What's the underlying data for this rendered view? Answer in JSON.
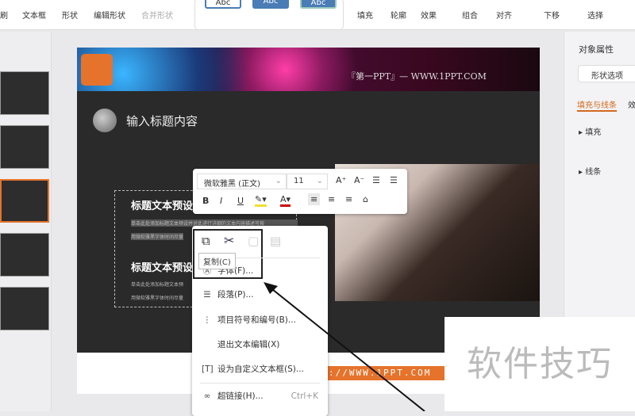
{
  "ribbon": {
    "items": [
      "文本框",
      "形状",
      "编辑形状",
      "合并形状",
      "填充",
      "轮廓",
      "效果",
      "组合",
      "对齐",
      "下移",
      "选择"
    ],
    "styles": [
      "Abc",
      "Abc",
      "Abc"
    ],
    "left_fragment": "刷"
  },
  "slide": {
    "header_text": "『第一PPT』— WWW.1PPT.COM",
    "title": "输入标题内容",
    "block_title_1": "标题文本预设",
    "block_text_1a": "单击此处添加标题文本预设并对此进行详细的文本内容描述可按",
    "block_text_1b": "用微软雅黑字体时间尽量",
    "block_title_2": "标题文本预设",
    "block_text_2a": "单击此处添加标题文本预",
    "block_text_2b": "用微软雅黑字体时间尽量",
    "footer_url": "://WWW.1PPT.COM"
  },
  "font_toolbar": {
    "font": "微软雅黑 (正文)",
    "size": "11",
    "bold": "B",
    "italic": "I",
    "underline": "U"
  },
  "context_menu": {
    "tooltip": "复制(C)",
    "items": [
      {
        "label": "字体(F)...",
        "icon": "font-icon"
      },
      {
        "label": "段落(P)...",
        "icon": "paragraph-icon"
      },
      {
        "label": "项目符号和编号(B)...",
        "icon": "list-icon"
      },
      {
        "label": "退出文本编辑(X)",
        "icon": ""
      },
      {
        "label": "设为自定义文本框(S)...",
        "icon": "textbox-icon"
      },
      {
        "label": "超链接(H)...",
        "icon": "link-icon",
        "shortcut": "Ctrl+K"
      }
    ]
  },
  "panel": {
    "title": "对象属性",
    "tab": "形状选项",
    "subtab_active": "填充与线条",
    "subtab_other": "效",
    "sections": [
      "填充",
      "线条"
    ]
  },
  "watermark": "软件技巧",
  "colors": {
    "accent": "#d2691e",
    "url_bar": "#e6732c"
  }
}
